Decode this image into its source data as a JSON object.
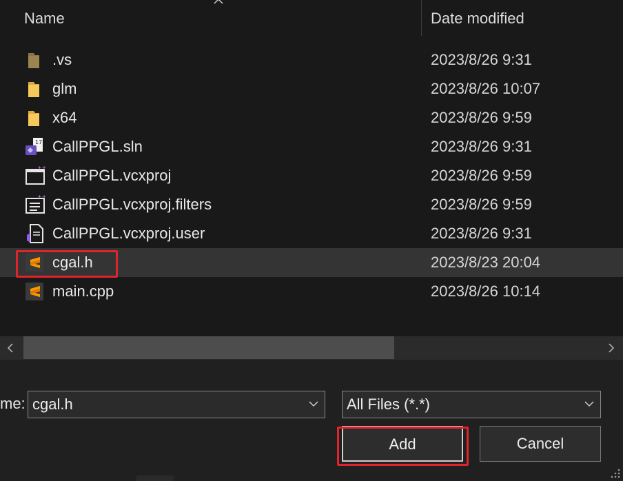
{
  "header": {
    "name_label": "Name",
    "date_label": "Date modified",
    "sort_icon": "chevron-up-icon"
  },
  "files": [
    {
      "name": ".vs",
      "date": "2023/8/26 9:31",
      "icon": "folder-hidden-icon",
      "selected": false
    },
    {
      "name": "glm",
      "date": "2023/8/26 10:07",
      "icon": "folder-icon",
      "selected": false
    },
    {
      "name": "x64",
      "date": "2023/8/26 9:59",
      "icon": "folder-icon",
      "selected": false
    },
    {
      "name": "CallPPGL.sln",
      "date": "2023/8/26 9:31",
      "icon": "vs-solution-icon",
      "selected": false
    },
    {
      "name": "CallPPGL.vcxproj",
      "date": "2023/8/26 9:59",
      "icon": "vcxproj-icon",
      "selected": false
    },
    {
      "name": "CallPPGL.vcxproj.filters",
      "date": "2023/8/26 9:59",
      "icon": "vcxproj-filters-icon",
      "selected": false
    },
    {
      "name": "CallPPGL.vcxproj.user",
      "date": "2023/8/26 9:31",
      "icon": "vs-user-file-icon",
      "selected": false
    },
    {
      "name": "cgal.h",
      "date": "2023/8/23 20:04",
      "icon": "sublime-file-icon",
      "selected": true
    },
    {
      "name": "main.cpp",
      "date": "2023/8/26 10:14",
      "icon": "sublime-file-icon",
      "selected": false
    }
  ],
  "bottom": {
    "filename_label": "me:",
    "filename_value": "cgal.h",
    "filter_value": "All Files (*.*)",
    "add_label": "Add",
    "cancel_label": "Cancel"
  },
  "colors": {
    "background": "#191919",
    "selection": "#343434",
    "annotation_red": "#e0242b",
    "folder_yellow": "#f2c14e",
    "sublime_orange": "#ff9800"
  }
}
